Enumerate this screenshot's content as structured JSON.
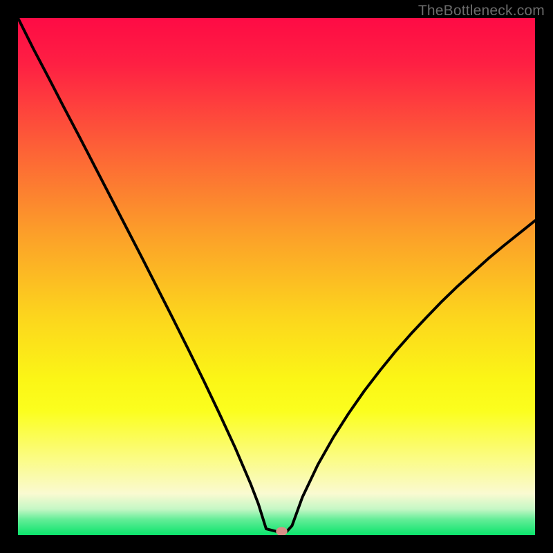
{
  "watermark": "TheBottleneck.com",
  "chart_data": {
    "type": "line",
    "title": "",
    "xlabel": "",
    "ylabel": "",
    "xlim": [
      0,
      100
    ],
    "ylim": [
      0,
      100
    ],
    "grid": false,
    "legend": false,
    "x": [
      0,
      3,
      6,
      9,
      12,
      15,
      18,
      21,
      24,
      27,
      30,
      33,
      36,
      39,
      42,
      45,
      46.5,
      48,
      50,
      52,
      53,
      55,
      58,
      61,
      64,
      67,
      70,
      73,
      76,
      79,
      82,
      85,
      88,
      91,
      94,
      97,
      100
    ],
    "values": [
      100,
      94,
      88.3,
      82.5,
      76.8,
      71,
      65.2,
      59.4,
      53.6,
      47.7,
      41.8,
      35.8,
      29.7,
      23.4,
      16.9,
      9.9,
      6,
      1.2,
      0.7,
      0.7,
      1.8,
      7.3,
      13.6,
      18.9,
      23.6,
      27.9,
      31.8,
      35.5,
      38.9,
      42.1,
      45.2,
      48.1,
      50.8,
      53.5,
      56,
      58.4,
      60.8
    ],
    "marker": {
      "x": 51,
      "y": 0.7,
      "color": "#d98f87"
    },
    "background_gradient": {
      "stops": [
        {
          "pct": 0,
          "color": "#fe0b45"
        },
        {
          "pct": 9,
          "color": "#fe2043"
        },
        {
          "pct": 25,
          "color": "#fd6037"
        },
        {
          "pct": 42,
          "color": "#fca029"
        },
        {
          "pct": 58,
          "color": "#fcd61d"
        },
        {
          "pct": 70,
          "color": "#fbf616"
        },
        {
          "pct": 76,
          "color": "#fbfe1e"
        },
        {
          "pct": 84,
          "color": "#fbfc77"
        },
        {
          "pct": 92,
          "color": "#fafad1"
        },
        {
          "pct": 95,
          "color": "#c4f7c5"
        },
        {
          "pct": 97,
          "color": "#63ed97"
        },
        {
          "pct": 100,
          "color": "#0be46c"
        }
      ]
    }
  }
}
